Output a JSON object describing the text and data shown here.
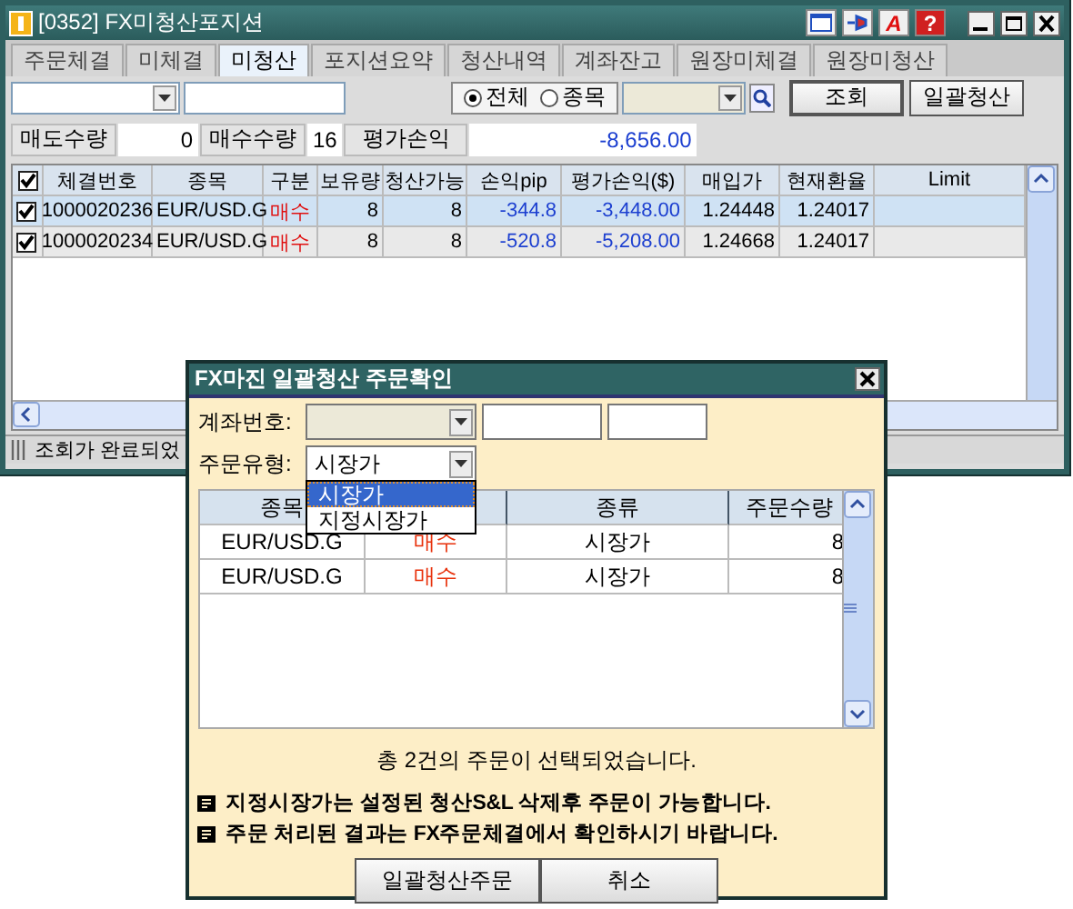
{
  "window": {
    "title": "[0352] FX미청산포지션"
  },
  "title_buttons": [
    {
      "kind": "layout"
    },
    {
      "kind": "pin"
    },
    {
      "kind": "text",
      "label": "A"
    },
    {
      "kind": "text",
      "label": "?"
    }
  ],
  "tabs": [
    {
      "label": "주문체결",
      "selected": false
    },
    {
      "label": "미체결",
      "selected": false
    },
    {
      "label": "미청산",
      "selected": true
    },
    {
      "label": "포지션요약",
      "selected": false
    },
    {
      "label": "청산내역",
      "selected": false
    },
    {
      "label": "계좌잔고",
      "selected": false
    },
    {
      "label": "원장미체결",
      "selected": false
    },
    {
      "label": "원장미청산",
      "selected": false
    }
  ],
  "scope_options": [
    {
      "label": "전체",
      "selected": true
    },
    {
      "label": "종목",
      "selected": false
    }
  ],
  "buttons": [
    "조회",
    "일괄청산"
  ],
  "summary": [
    {
      "label": "매도수량",
      "value": "0"
    },
    {
      "label": "매수수량",
      "value": "16"
    },
    {
      "label": "평가손익",
      "value": "-8,656.00"
    }
  ],
  "table": {
    "all_checked": true,
    "columns": [
      "체결번호",
      "종목",
      "구분",
      "보유량",
      "청산가능",
      "손익pip",
      "평가손익($)",
      "매입가",
      "현재환율",
      "Limit"
    ],
    "rows": [
      {
        "checked": true,
        "selected": true,
        "cells": [
          "1000020236",
          "EUR/USD.G",
          "매수",
          "8",
          "8",
          "-344.8",
          "-3,448.00",
          "1.24448",
          "1.24017"
        ]
      },
      {
        "checked": true,
        "selected": false,
        "cells": [
          "1000020234",
          "EUR/USD.G",
          "매수",
          "8",
          "8",
          "-520.8",
          "-5,208.00",
          "1.24668",
          "1.24017"
        ]
      }
    ]
  },
  "status_bar": "조회가 완료되었",
  "dialog": {
    "title": "FX마진 일괄청산 주문확인",
    "account_label": "계좌번호:",
    "order_type_label": "주문유형:",
    "order_type": "시장가",
    "dropdown": [
      {
        "label": "시장가",
        "selected": true
      },
      {
        "label": "지정시장가",
        "selected": false
      }
    ],
    "grid": {
      "columns": [
        {
          "label": "종목"
        },
        {},
        {
          "label": "종류"
        },
        {
          "label": "주문수량"
        }
      ],
      "rows": [
        {
          "cells": [
            "EUR/USD.G",
            "매수",
            "시장가",
            "8"
          ]
        },
        {
          "cells": [
            "EUR/USD.G",
            "매수",
            "시장가",
            "8"
          ]
        }
      ]
    },
    "message": "총 2건의 주문이 선택되었습니다.",
    "notes": [
      "지정시장가는 설정된 청산S&L 삭제후 주문이 가능합니다.",
      "주문 처리된 결과는 FX주문체결에서 확인하시기 바랍니다."
    ],
    "buttons": [
      "일괄청산주문",
      "취소"
    ]
  }
}
